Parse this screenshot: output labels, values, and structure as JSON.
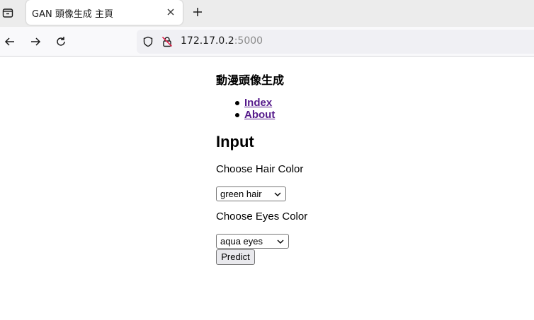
{
  "browser": {
    "tab": {
      "title": "GAN 頭像生成 主頁"
    },
    "url": {
      "host": "172.17.0.2",
      "port": ":5000"
    },
    "icons": {
      "tab_overview": "tab-overview-icon",
      "tab_close": "close-icon",
      "new_tab": "plus-icon",
      "back": "arrow-left-icon",
      "forward": "arrow-right-icon",
      "reload": "reload-icon",
      "shield": "shield-icon",
      "insecure": "insecure-lock-icon"
    }
  },
  "page": {
    "site_title": "動漫頭像生成",
    "nav": [
      {
        "label": "Index"
      },
      {
        "label": "About"
      }
    ],
    "heading": "Input",
    "hair": {
      "label": "Choose Hair Color",
      "selected": "green hair"
    },
    "eyes": {
      "label": "Choose Eyes Color",
      "selected": "aqua eyes"
    },
    "submit_label": "Predict"
  },
  "colors": {
    "link_visited": "#551a8b",
    "tabbar_bg": "#ececec",
    "navbar_bg": "#f9f9fb",
    "urlbar_bg": "#f0f0f4",
    "insecure_red": "#e22850"
  }
}
